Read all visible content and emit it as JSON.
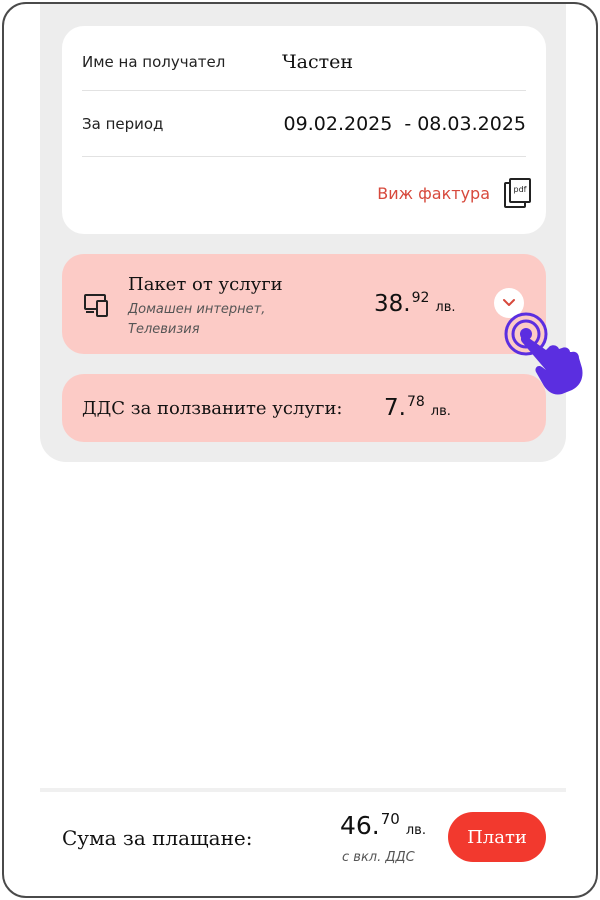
{
  "invoice": {
    "recipient_label": "Име на получател",
    "recipient_value": "Частен",
    "period_label": "За период",
    "period_from": "09.02.2025",
    "period_to": "08.03.2025",
    "period_separator": "-",
    "view_invoice_label": "Виж фактура",
    "pdf_icon_text": "pdf"
  },
  "services": {
    "title": "Пакет от услуги",
    "subtitle": "Домашен интернет, Телевизия",
    "price_int": "38.",
    "price_dec": "92",
    "currency": "лв."
  },
  "vat": {
    "label": "ДДС за ползваните услуги:",
    "price_int": "7.",
    "price_dec": "78",
    "currency": "лв."
  },
  "total": {
    "label": "Сума за плащане:",
    "price_int": "46.",
    "price_dec": "70",
    "currency": "лв.",
    "note": "с вкл. ДДС",
    "pay_label": "Плати"
  },
  "icons": {
    "invoice": "pdf-document-icon",
    "services": "devices-icon",
    "expand": "chevron-down-icon",
    "pointer": "tap-hand-icon"
  },
  "colors": {
    "accent": "#f2392e",
    "link": "#d7493c",
    "card_pink": "#fccbc6",
    "panel_gray": "#ededed",
    "hand": "#5b2ee0"
  }
}
